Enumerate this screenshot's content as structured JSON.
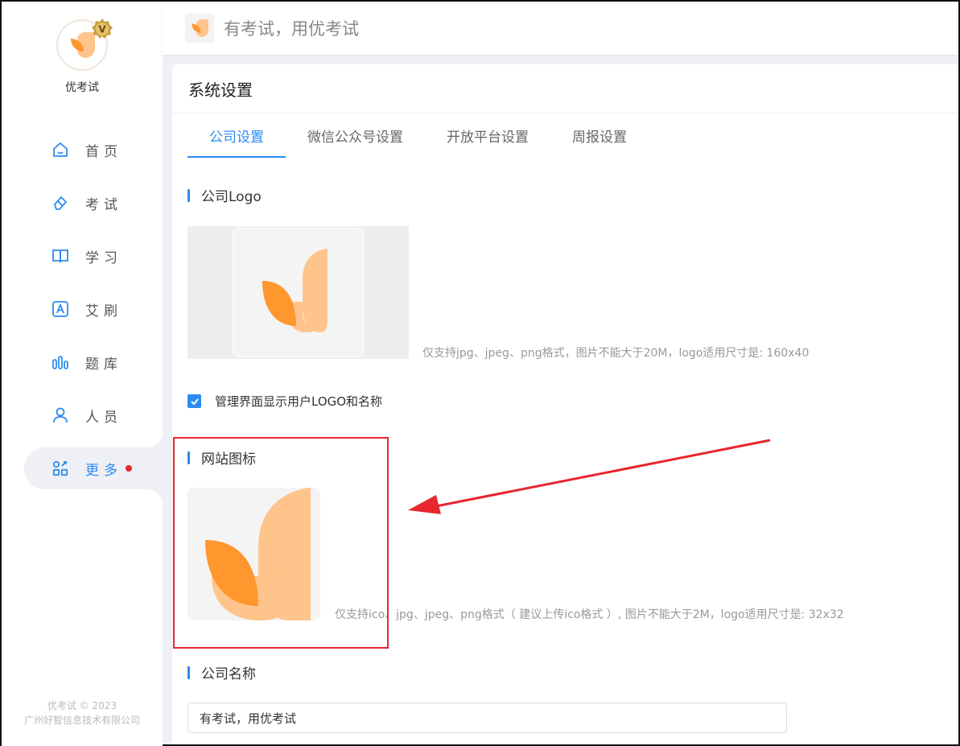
{
  "sidebar": {
    "brand_name": "优考试",
    "vip_badge": "V",
    "items": [
      {
        "label": "首页",
        "icon": "home-icon"
      },
      {
        "label": "考试",
        "icon": "eraser-icon"
      },
      {
        "label": "学习",
        "icon": "book-icon"
      },
      {
        "label": "艾刷",
        "icon": "letter-a-icon"
      },
      {
        "label": "题库",
        "icon": "bars-icon"
      },
      {
        "label": "人员",
        "icon": "user-icon"
      },
      {
        "label": "更多",
        "icon": "grid-apps-icon",
        "active": true,
        "has_dot": true
      }
    ],
    "copyright_line1": "优考试 © 2023",
    "copyright_line2": "广州好智信息技术有限公司"
  },
  "topbar": {
    "title": "有考试，用优考试"
  },
  "page": {
    "title": "系统设置",
    "tabs": [
      {
        "label": "公司设置",
        "active": true
      },
      {
        "label": "微信公众号设置",
        "active": false
      },
      {
        "label": "开放平台设置",
        "active": false
      },
      {
        "label": "周报设置",
        "active": false
      }
    ],
    "logo_section": {
      "title": "公司Logo",
      "hint": "仅支持jpg、jpeg、png格式，图片不能大于20M，logo适用尺寸是: 160x40"
    },
    "show_logo_checkbox": {
      "label": "管理界面显示用户LOGO和名称",
      "checked": true
    },
    "favicon_section": {
      "title": "网站图标",
      "hint": "仅支持ico、jpg、jpeg、png格式（ 建议上传ico格式 ）, 图片不能大于2M，logo适用尺寸是: 32x32"
    },
    "company_name_section": {
      "title": "公司名称",
      "value": "有考试，用优考试"
    }
  },
  "colors": {
    "accent": "#2d8cf0",
    "logo_light": "#ffc48b",
    "logo_dark": "#ff962e",
    "annotation": "#e8262d"
  }
}
